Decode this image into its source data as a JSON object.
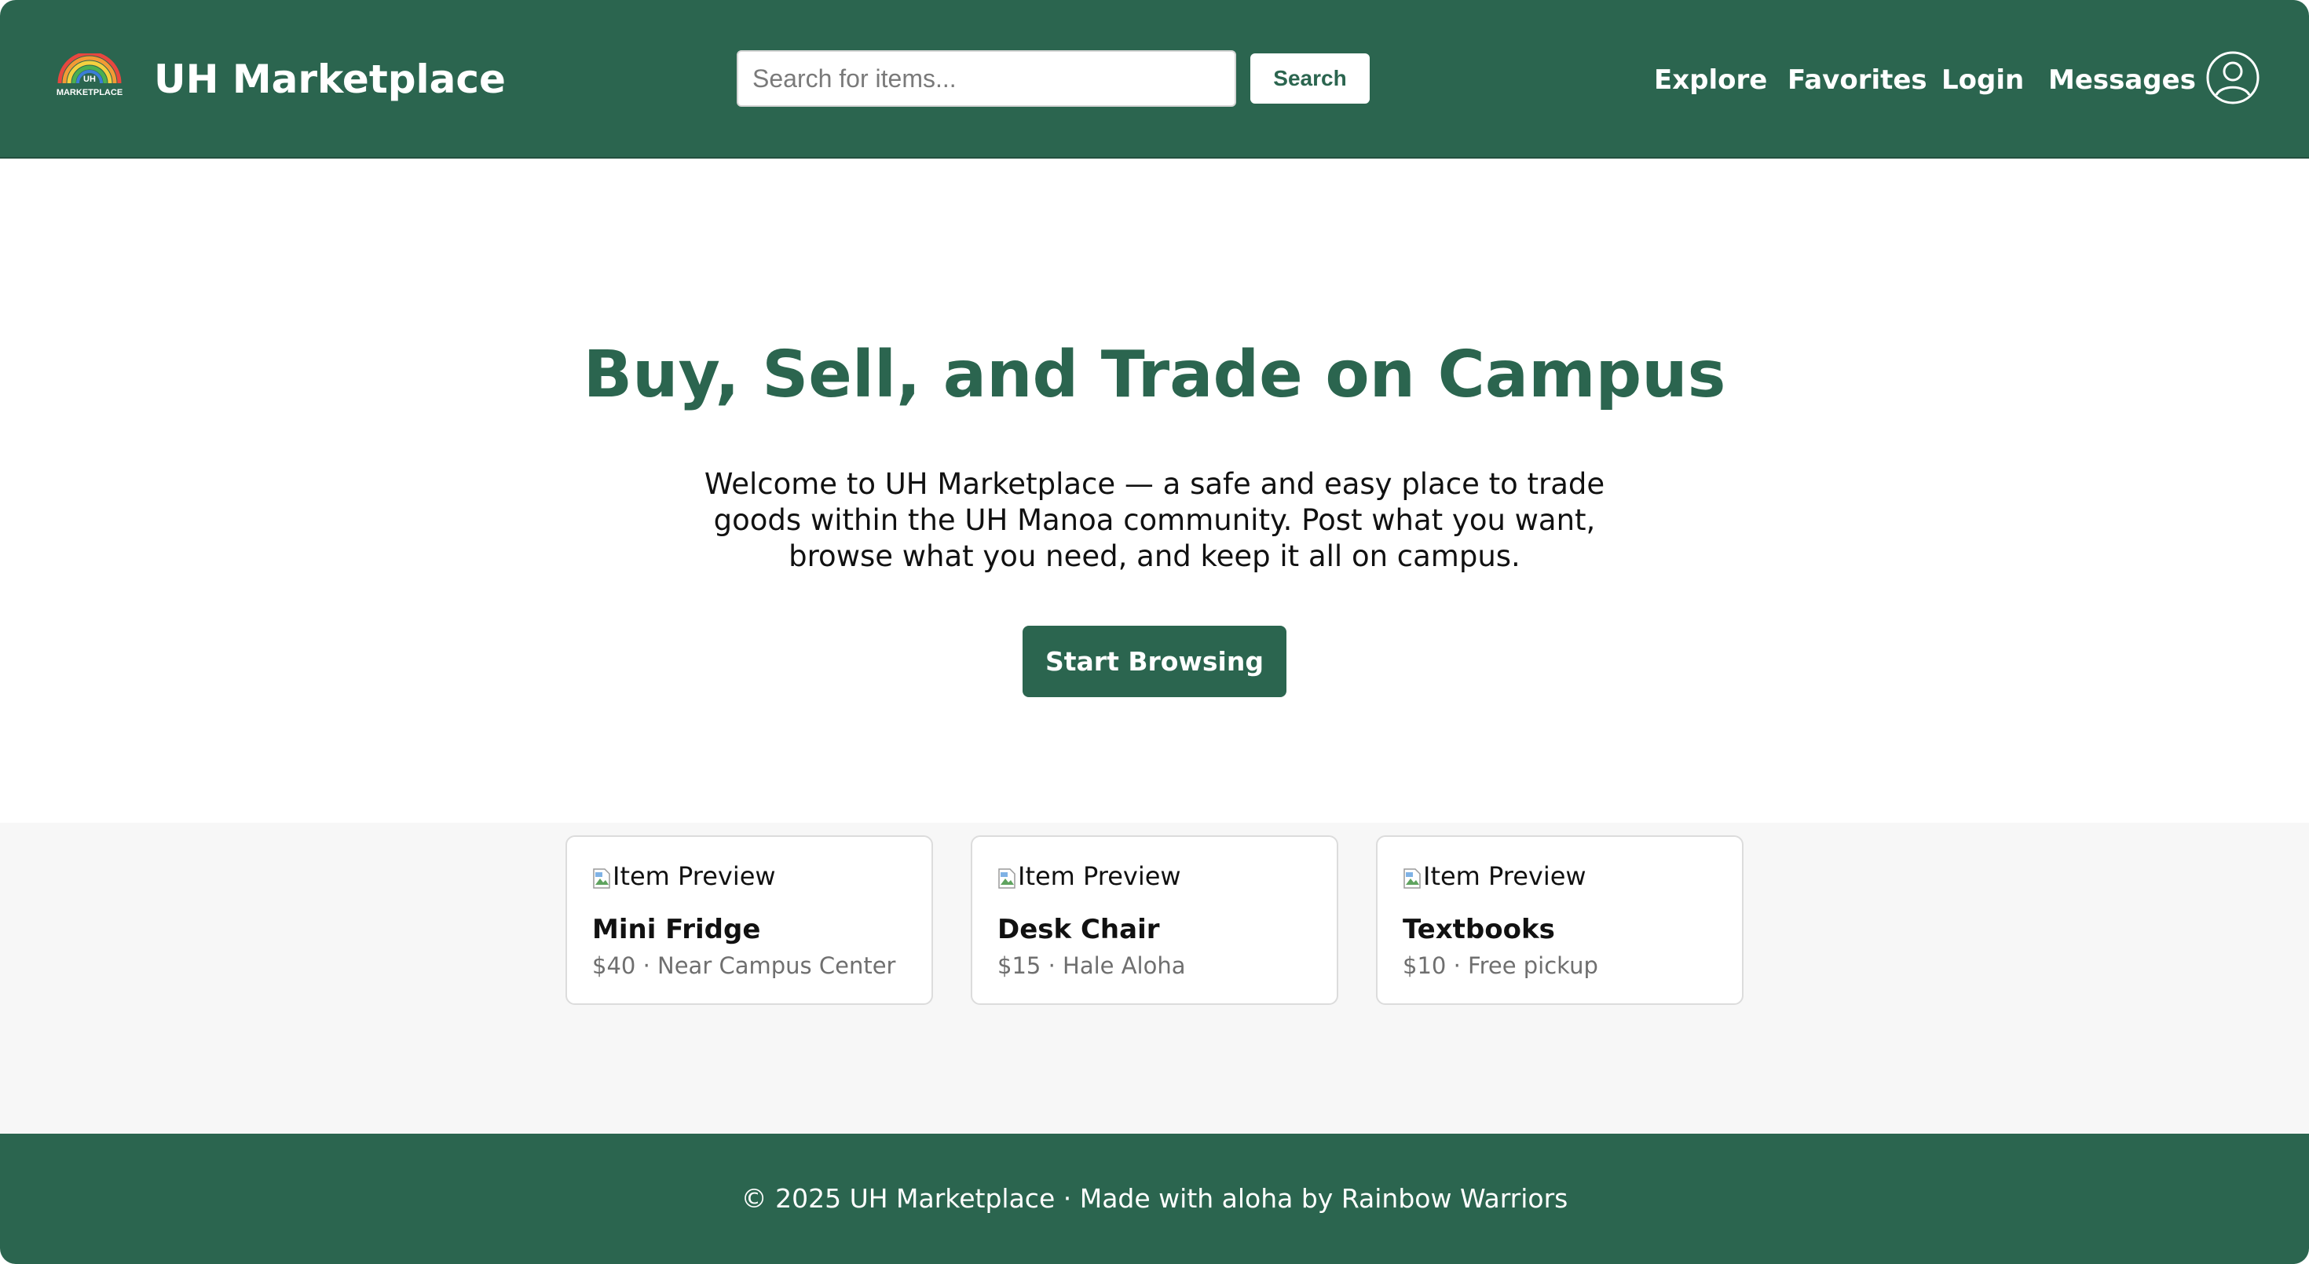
{
  "header": {
    "logo_text_top": "UH",
    "logo_text_bottom": "MARKETPLACE",
    "brand": "UH Marketplace",
    "search": {
      "placeholder": "Search for items...",
      "value": "",
      "button_label": "Search"
    },
    "nav": {
      "explore": "Explore",
      "favorites": "Favorites",
      "login": "Login",
      "messages": "Messages"
    },
    "profile_icon": "user-circle-icon"
  },
  "hero": {
    "title": "Buy, Sell, and Trade on Campus",
    "description": "Welcome to UH Marketplace — a safe and easy place to trade goods within the UH Manoa community. Post what you want, browse what you need, and keep it all on campus.",
    "cta_label": "Start Browsing"
  },
  "listings": [
    {
      "image_alt": "Item Preview",
      "title": "Mini Fridge",
      "price": "$40",
      "separator": "·",
      "location": "Near Campus Center"
    },
    {
      "image_alt": "Item Preview",
      "title": "Desk Chair",
      "price": "$15",
      "separator": "·",
      "location": "Hale Aloha"
    },
    {
      "image_alt": "Item Preview",
      "title": "Textbooks",
      "price": "$10",
      "separator": "·",
      "location": "Free pickup"
    }
  ],
  "footer": {
    "text": "© 2025 UH Marketplace · Made with aloha by Rainbow Warriors"
  },
  "colors": {
    "primary": "#2b654f",
    "section_background": "#f7f7f7",
    "meta_text": "#6f6f6f"
  }
}
